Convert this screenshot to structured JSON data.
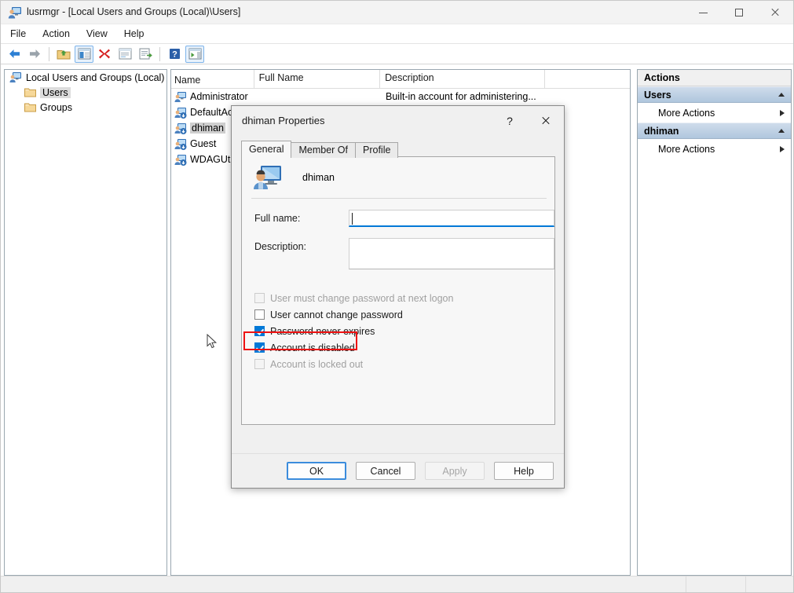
{
  "window": {
    "title": "lusrmgr - [Local Users and Groups (Local)\\Users]",
    "icon": "lusrmgr-icon",
    "minimize_label": "Minimize",
    "maximize_label": "Maximize",
    "close_label": "Close"
  },
  "menu": [
    "File",
    "Action",
    "View",
    "Help"
  ],
  "toolbar": [
    {
      "name": "back-icon",
      "label": "Back"
    },
    {
      "name": "forward-icon",
      "label": "Forward"
    },
    {
      "name": "up-folder-icon",
      "label": "Up One Level"
    },
    {
      "name": "show-tree-icon",
      "label": "Show/Hide Console Tree"
    },
    {
      "name": "delete-icon",
      "label": "Delete"
    },
    {
      "name": "properties-icon",
      "label": "Properties"
    },
    {
      "name": "export-list-icon",
      "label": "Export List"
    },
    {
      "name": "help-icon",
      "label": "Help"
    },
    {
      "name": "show-action-pane-icon",
      "label": "Show/Hide Action Pane"
    }
  ],
  "tree": {
    "root": "Local Users and Groups (Local)",
    "children": [
      {
        "label": "Users",
        "selected": true
      },
      {
        "label": "Groups",
        "selected": false
      }
    ]
  },
  "list": {
    "columns": [
      "Name",
      "Full Name",
      "Description"
    ],
    "rows": [
      {
        "name": "Administrator",
        "full_name": "",
        "description": "Built-in account for administering...",
        "selected": false,
        "disabled": false
      },
      {
        "name": "DefaultAc",
        "full_name": "",
        "description": "",
        "selected": false,
        "disabled": true
      },
      {
        "name": "dhiman",
        "full_name": "",
        "description": "",
        "selected": true,
        "disabled": true
      },
      {
        "name": "Guest",
        "full_name": "",
        "description": "",
        "selected": false,
        "disabled": true
      },
      {
        "name": "WDAGUti",
        "full_name": "",
        "description": "",
        "selected": false,
        "disabled": true
      }
    ]
  },
  "actions": {
    "header": "Actions",
    "sections": [
      {
        "title": "Users",
        "items": [
          "More Actions"
        ]
      },
      {
        "title": "dhiman",
        "items": [
          "More Actions"
        ]
      }
    ]
  },
  "dialog": {
    "title": "dhiman Properties",
    "help_glyph": "?",
    "tabs": [
      {
        "label": "General",
        "active": true
      },
      {
        "label": "Member Of",
        "active": false
      },
      {
        "label": "Profile",
        "active": false
      }
    ],
    "user_name": "dhiman",
    "fields": [
      {
        "label": "Full name:",
        "value": "",
        "focused": true
      },
      {
        "label": "Description:",
        "value": "",
        "focused": false
      }
    ],
    "checkboxes": [
      {
        "label": "User must change password at next logon",
        "checked": false,
        "enabled": false
      },
      {
        "label": "User cannot change password",
        "checked": false,
        "enabled": true
      },
      {
        "label": "Password never expires",
        "checked": true,
        "enabled": true
      },
      {
        "label": "Account is disabled",
        "checked": true,
        "enabled": true,
        "highlighted": true
      },
      {
        "label": "Account is locked out",
        "checked": false,
        "enabled": false
      }
    ],
    "buttons": [
      {
        "label": "OK",
        "default": true,
        "enabled": true
      },
      {
        "label": "Cancel",
        "default": false,
        "enabled": true
      },
      {
        "label": "Apply",
        "default": false,
        "enabled": false
      },
      {
        "label": "Help",
        "default": false,
        "enabled": true
      }
    ]
  },
  "colors": {
    "accent": "#0078d7",
    "highlight_box": "#ee1111",
    "section_header": "#afc6dd",
    "selection": "#cfcfcf"
  }
}
